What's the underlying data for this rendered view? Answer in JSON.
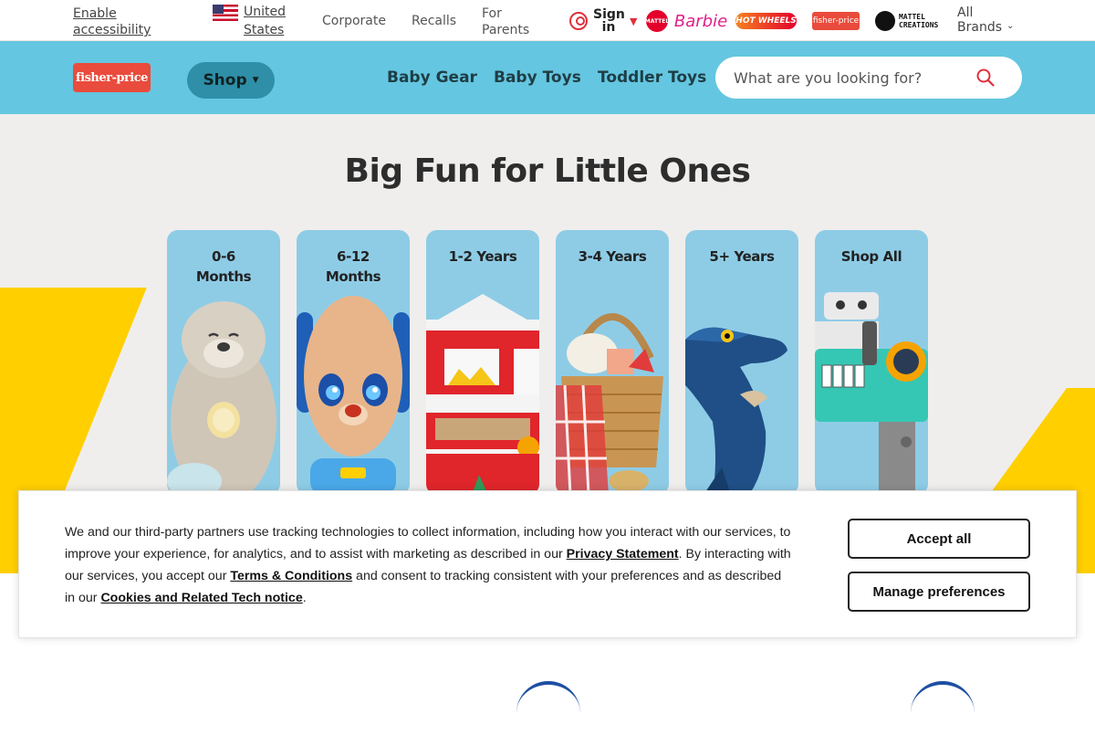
{
  "utility_bar": {
    "accessibility_link": "Enable accessibility",
    "country": "United States",
    "links": [
      "Corporate",
      "Recalls",
      "For Parents"
    ],
    "sign_in": "Sign in",
    "brands": [
      {
        "name": "Mattel",
        "text": "MATTEL"
      },
      {
        "name": "Barbie",
        "text": "Barbie"
      },
      {
        "name": "Hot Wheels",
        "text": "HOT WHEELS"
      },
      {
        "name": "Fisher-Price",
        "text": "fisher-price"
      },
      {
        "name": "Mattel Creations",
        "text": "MATTEL CREATIONS"
      }
    ],
    "all_brands": "All Brands"
  },
  "header": {
    "logo_text": "fisher-price",
    "shop_label": "Shop",
    "nav": [
      "Baby Gear",
      "Baby Toys",
      "Toddler Toys"
    ],
    "search_placeholder": "What are you looking for?"
  },
  "hero": {
    "title": "Big Fun for Little Ones",
    "cards": [
      {
        "label": "0-6 Months",
        "image": "otter-plush"
      },
      {
        "label": "6-12 Months",
        "image": "puppy-plush"
      },
      {
        "label": "1-2 Years",
        "image": "barn-playset"
      },
      {
        "label": "3-4 Years",
        "image": "picnic-basket"
      },
      {
        "label": "5+ Years",
        "image": "dinosaur-figure"
      },
      {
        "label": "Shop All",
        "image": "toy-piano-desk"
      }
    ]
  },
  "cookie_banner": {
    "text_1": "We and our third-party partners use tracking technologies to collect information, including how you interact with our services, to improve your experience, for analytics, and to assist with marketing as described in our ",
    "privacy_link": "Privacy Statement",
    "text_2": ". By interacting with our services, you accept our ",
    "terms_link": "Terms & Conditions",
    "text_3": " and consent to tracking consistent with your preferences and as described in our ",
    "cookies_link": "Cookies and Related Tech notice",
    "text_4": ".",
    "accept_label": "Accept all",
    "manage_label": "Manage preferences"
  },
  "colors": {
    "header_bg": "#64c6e0",
    "shop_button_bg": "#2f8fa8",
    "hero_bg": "#efeeec",
    "accent_yellow": "#ffcf00",
    "card_bg": "#8ecce6",
    "brand_red": "#e94b3c"
  }
}
